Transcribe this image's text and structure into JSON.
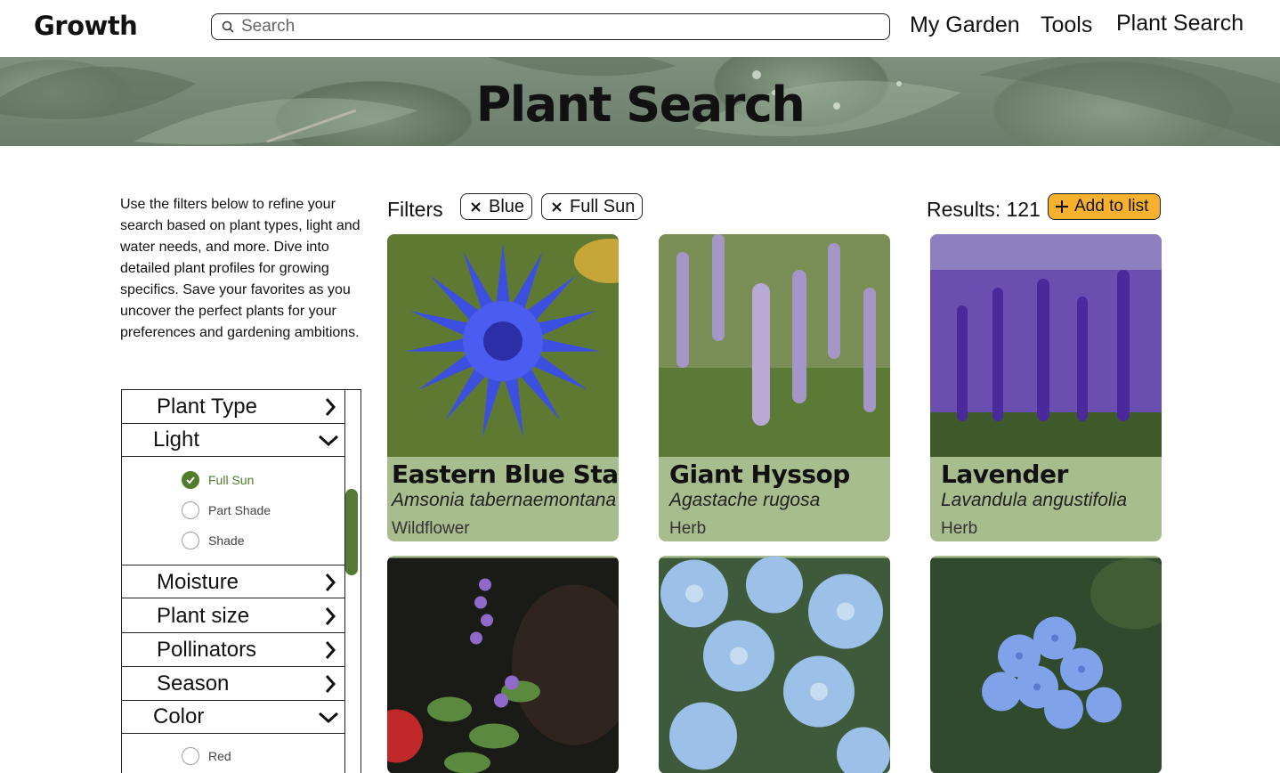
{
  "header": {
    "logo": "Growth",
    "search_placeholder": "Search",
    "nav": [
      "My Garden",
      "Tools",
      "Plant Search"
    ]
  },
  "hero": {
    "title": "Plant Search"
  },
  "sidebar": {
    "intro": "Use the filters below to refine your search based on plant types, light and water needs, and more. Dive into detailed plant profiles for growing specifics. Save your favorites as you uncover the perfect plants for your preferences and gardening ambitions.",
    "categories": [
      {
        "label": "Plant Type",
        "expanded": false
      },
      {
        "label": "Light",
        "expanded": true,
        "options": [
          {
            "label": "Full Sun",
            "checked": true
          },
          {
            "label": "Part Shade",
            "checked": false
          },
          {
            "label": "Shade",
            "checked": false
          }
        ]
      },
      {
        "label": "Moisture",
        "expanded": false
      },
      {
        "label": "Plant size",
        "expanded": false
      },
      {
        "label": "Pollinators",
        "expanded": false
      },
      {
        "label": "Season",
        "expanded": false
      },
      {
        "label": "Color",
        "expanded": true,
        "options": [
          {
            "label": "Red",
            "checked": false
          }
        ]
      }
    ]
  },
  "filters": {
    "label": "Filters",
    "chips": [
      "Blue",
      "Full Sun"
    ],
    "results": "Results: 121",
    "add_button": "Add to list"
  },
  "cards": [
    {
      "name": "Eastern Blue Star",
      "scientific": "Amsonia tabernaemontana",
      "type": "Wildflower",
      "image": "blue-cornflower"
    },
    {
      "name": "Giant Hyssop",
      "scientific": "Agastache rugosa",
      "type": "Herb",
      "image": "purple-spikes"
    },
    {
      "name": "Lavender",
      "scientific": "Lavandula angustifolia",
      "type": "Herb",
      "image": "lavender-field"
    },
    {
      "image": "purple-sage"
    },
    {
      "image": "light-blue-delphinium"
    },
    {
      "image": "blue-plumbago"
    }
  ],
  "colors": {
    "accent_green": "#4f7d2c",
    "card_bg": "#a7bd8e",
    "add_button": "#f7b12e"
  }
}
